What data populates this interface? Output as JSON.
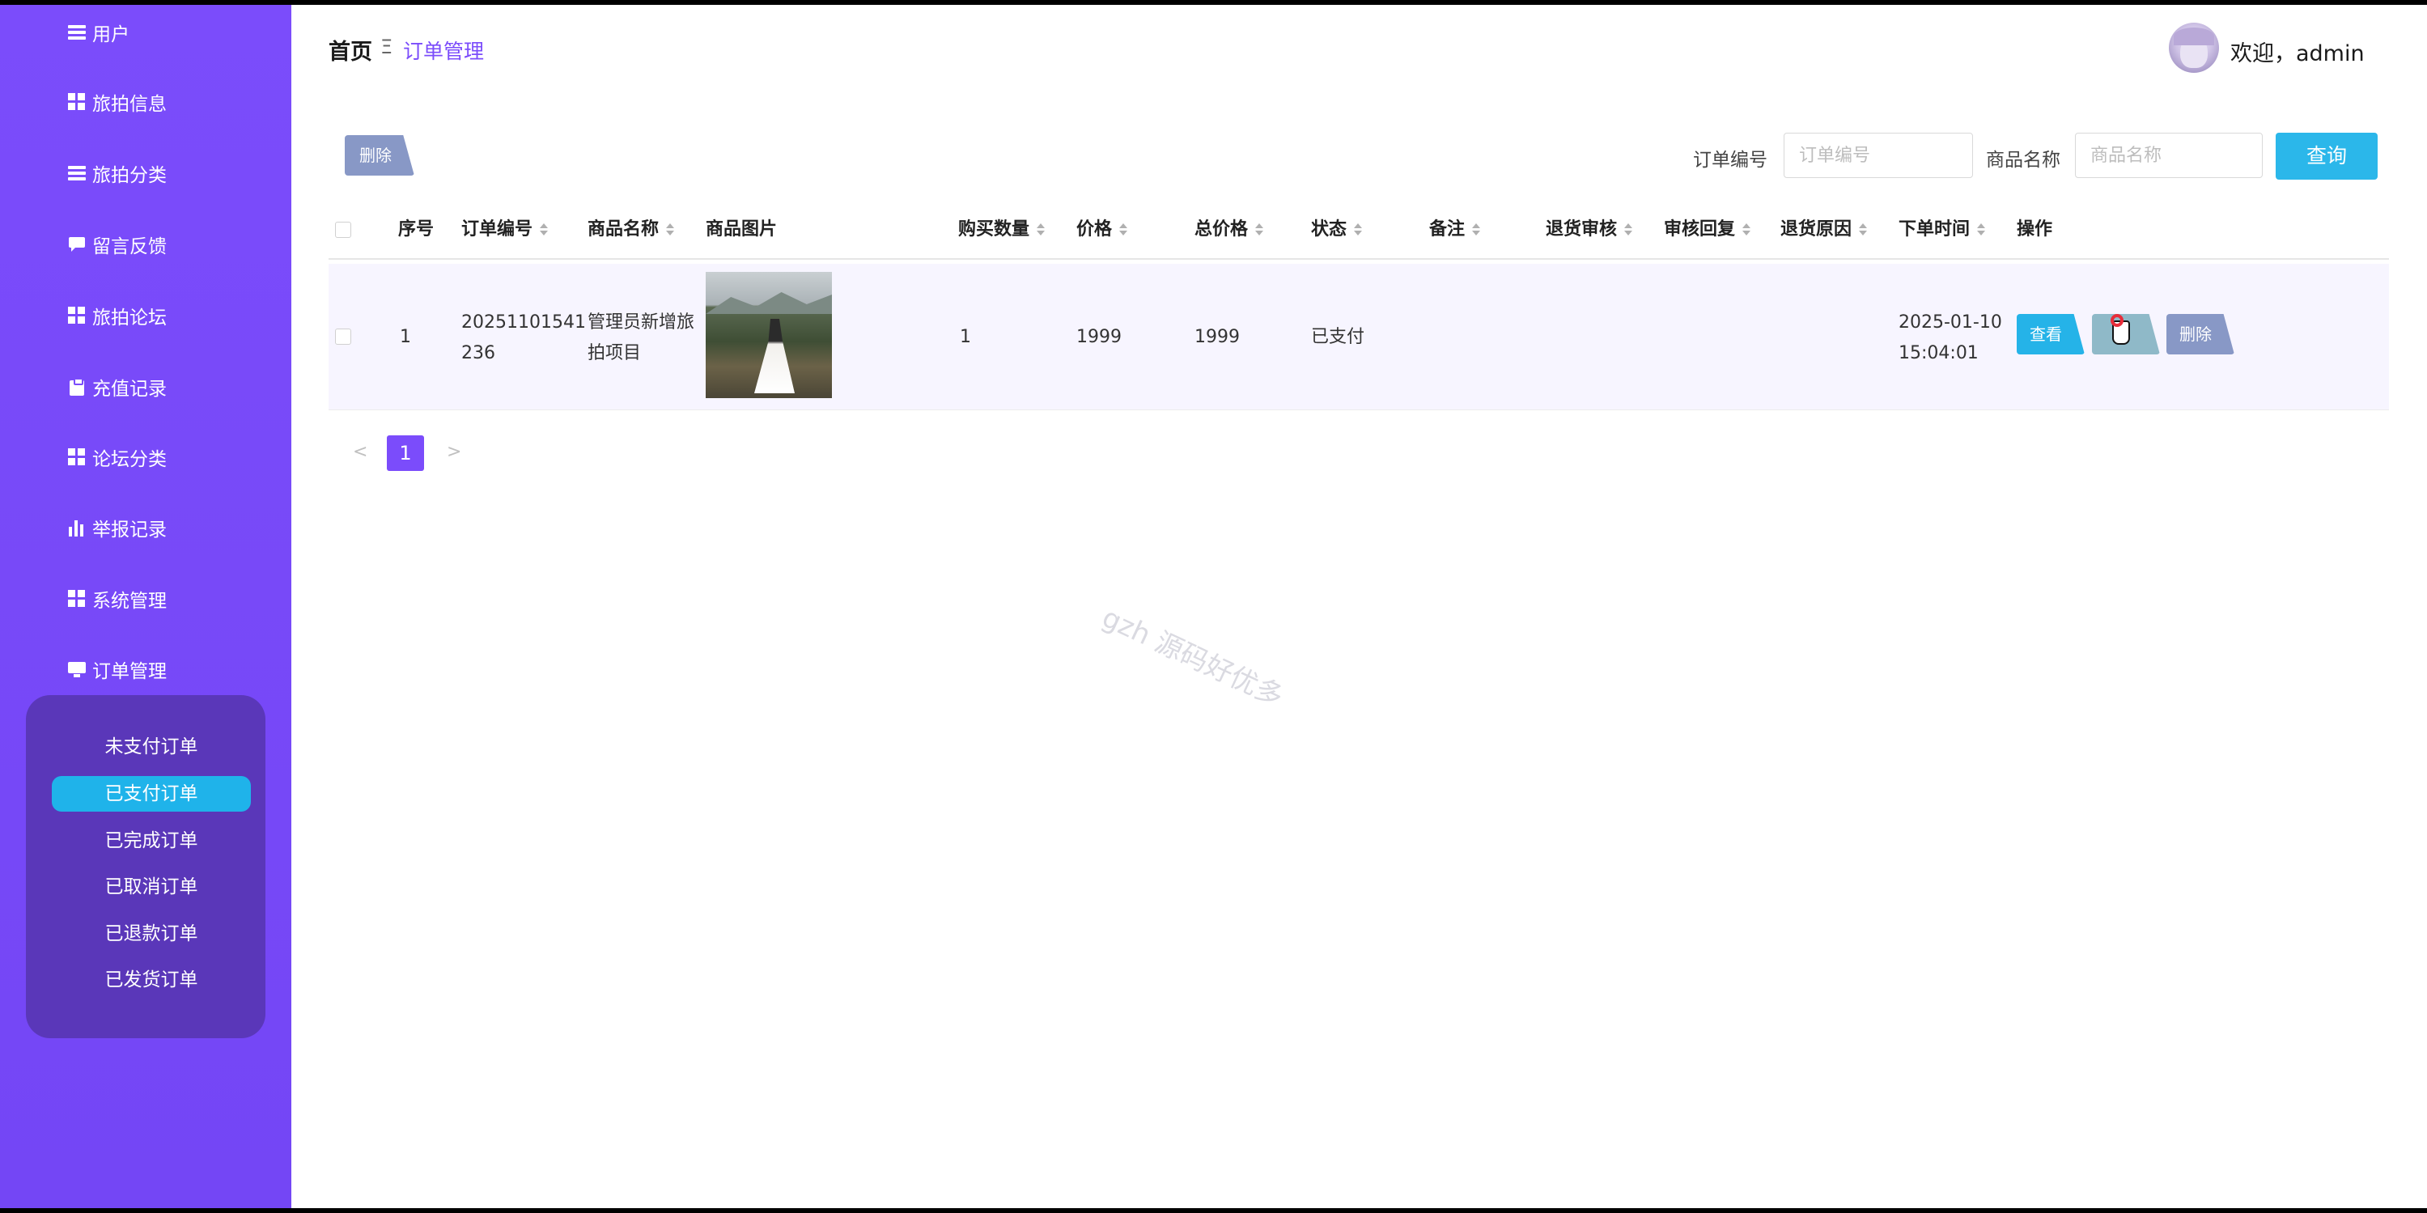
{
  "sidebar": {
    "items": [
      {
        "label": "用户",
        "icon": "list-icon"
      },
      {
        "label": "旅拍信息",
        "icon": "grid-icon"
      },
      {
        "label": "旅拍分类",
        "icon": "list-icon"
      },
      {
        "label": "留言反馈",
        "icon": "message-icon"
      },
      {
        "label": "旅拍论坛",
        "icon": "grid-icon"
      },
      {
        "label": "充值记录",
        "icon": "clipboard-icon"
      },
      {
        "label": "论坛分类",
        "icon": "grid-icon"
      },
      {
        "label": "举报记录",
        "icon": "bar-chart-icon"
      },
      {
        "label": "系统管理",
        "icon": "grid-icon"
      },
      {
        "label": "订单管理",
        "icon": "monitor-icon"
      }
    ],
    "submenu": [
      "未支付订单",
      "已支付订单",
      "已完成订单",
      "已取消订单",
      "已退款订单",
      "已发货订单"
    ],
    "active_submenu": "已支付订单"
  },
  "header": {
    "breadcrumb_home": "首页",
    "breadcrumb_sep": "Ξ",
    "breadcrumb_current": "订单管理",
    "welcome": "欢迎，admin"
  },
  "toolbar": {
    "delete_label": "删除",
    "order_no_label": "订单编号",
    "order_no_placeholder": "订单编号",
    "product_label": "商品名称",
    "product_placeholder": "商品名称",
    "query_label": "查询"
  },
  "table": {
    "columns": [
      "序号",
      "订单编号",
      "商品名称",
      "商品图片",
      "购买数量",
      "价格",
      "总价格",
      "状态",
      "备注",
      "退货审核",
      "审核回复",
      "退货原因",
      "下单时间",
      "操作"
    ],
    "rows": [
      {
        "index": "1",
        "order_no_1": "20251101541",
        "order_no_2": "236",
        "product_1": "管理员新增旅",
        "product_2": "拍项目",
        "qty": "1",
        "price": "1999",
        "total": "1999",
        "status": "已支付",
        "time_1": "2025-01-10",
        "time_2": "15:04:01",
        "actions": {
          "view": "查看",
          "edit": "修改",
          "delete": "删除"
        }
      }
    ]
  },
  "pagination": {
    "prev": "<",
    "current": "1",
    "next": ">"
  },
  "watermark": "gzh 源码好优多",
  "colors": {
    "sidebar": "#7b4cfb",
    "submenu_bg": "#5a37b9",
    "accent": "#1fb3ea",
    "page_active": "#7b4cfb"
  }
}
